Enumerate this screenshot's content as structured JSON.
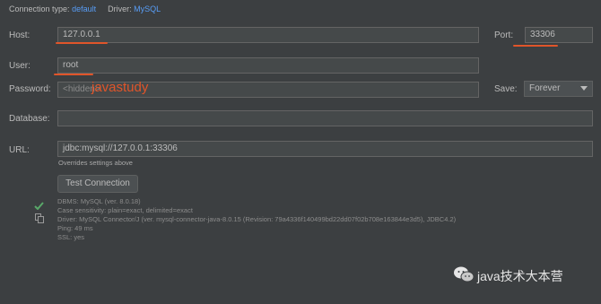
{
  "header": {
    "connection_type_label": "Connection type:",
    "connection_type_value": "default",
    "driver_label": "Driver:",
    "driver_value": "MySQL"
  },
  "form": {
    "host_label": "Host:",
    "host_value": "127.0.0.1",
    "port_label": "Port:",
    "port_value": "33306",
    "user_label": "User:",
    "user_value": "root",
    "password_label": "Password:",
    "password_value": "<hidden>",
    "save_label": "Save:",
    "save_value": "Forever",
    "database_label": "Database:",
    "database_value": "",
    "url_label": "URL:",
    "url_value": "jdbc:mysql://127.0.0.1:33306",
    "url_hint": "Overrides settings above"
  },
  "annotation": {
    "password_overlay": "javastudy"
  },
  "test_connection": {
    "button_label": "Test Connection"
  },
  "status": {
    "lines": [
      "DBMS: MySQL (ver. 8.0.18)",
      "Case sensitivity: plain=exact, delimited=exact",
      "Driver: MySQL Connector/J (ver. mysql-connector-java-8.0.15 (Revision: 79a4336f140499bd22dd07f02b708e163844e3d5), JDBC4.2)",
      "Ping: 49 ms",
      "SSL: yes"
    ]
  },
  "watermark": {
    "text": "java技术大本营"
  },
  "colors": {
    "background": "#3c3f41",
    "field_bg": "#45494a",
    "link": "#589df6",
    "annotation_red": "#e0552a",
    "success_green": "#59a869"
  }
}
